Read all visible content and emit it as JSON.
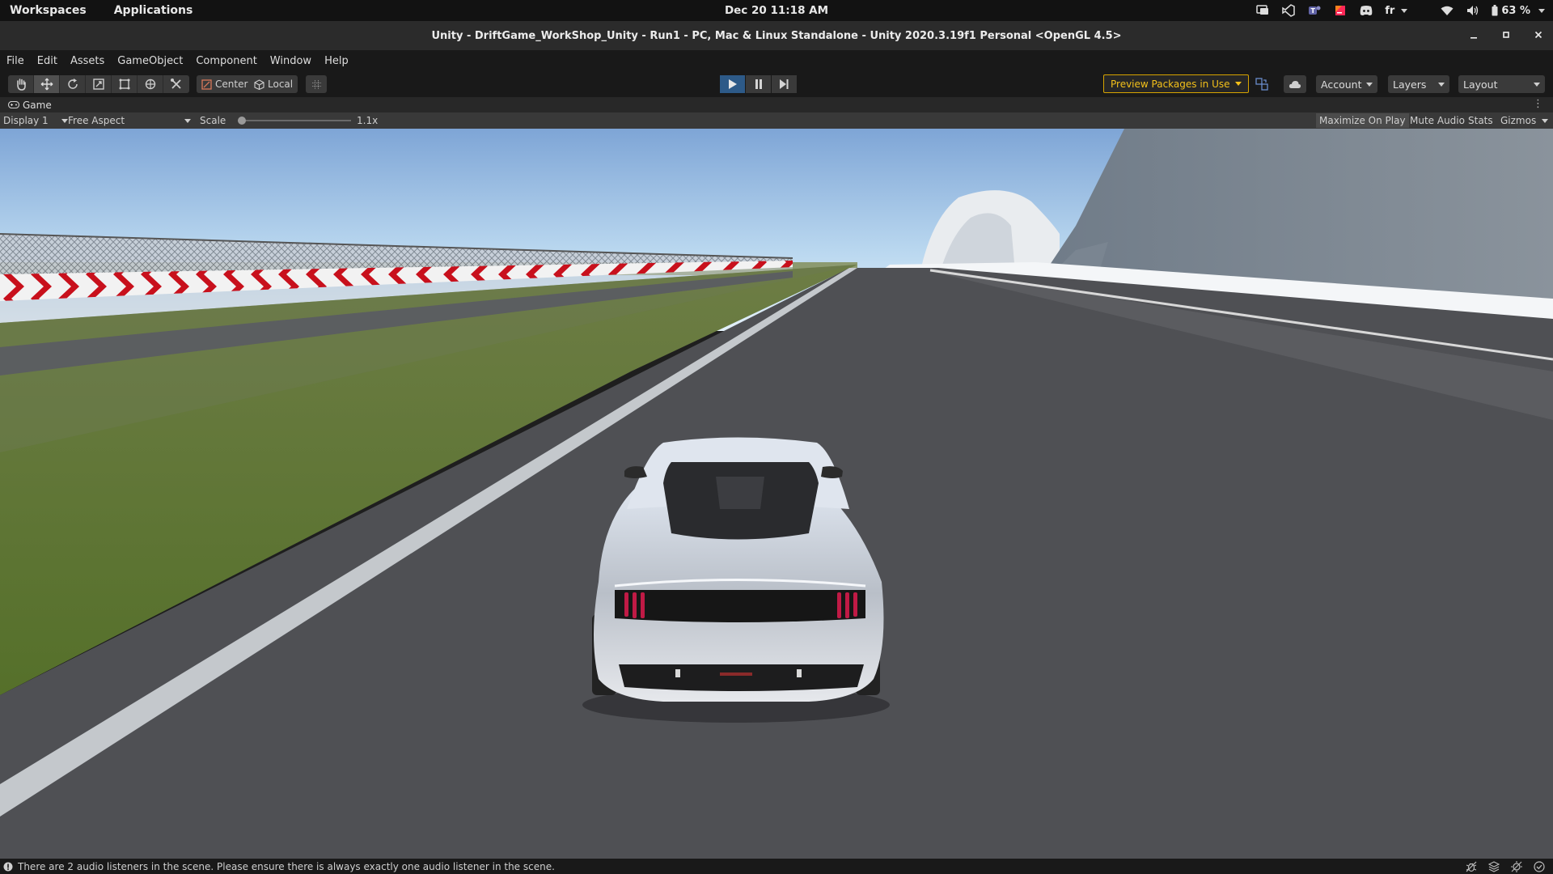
{
  "topbar": {
    "workspaces": "Workspaces",
    "applications": "Applications",
    "clock": "Dec 20  11:18 AM",
    "keyboard_layout": "fr",
    "battery": "63 %"
  },
  "window": {
    "title": "Unity - DriftGame_WorkShop_Unity - Run1 - PC, Mac & Linux Standalone - Unity 2020.3.19f1 Personal <OpenGL 4.5>"
  },
  "menu": [
    "File",
    "Edit",
    "Assets",
    "GameObject",
    "Component",
    "Window",
    "Help"
  ],
  "toolbar": {
    "tools": [
      "hand-tool-icon",
      "move-tool-icon",
      "rotate-tool-icon",
      "scale-tool-icon",
      "rect-tool-icon",
      "transform-tool-icon",
      "custom-tool-icon"
    ],
    "pivot_center": "Center",
    "pivot_local": "Local",
    "preview_packages": "Preview Packages in Use",
    "account": "Account",
    "layers": "Layers",
    "layout": "Layout",
    "play_active": true
  },
  "game_tab": {
    "label": "Game"
  },
  "game_view": {
    "display": "Display 1",
    "aspect": "Free Aspect",
    "scale_label": "Scale",
    "scale_value": "1.1x",
    "maximize_on_play": "Maximize On Play",
    "mute_audio": "Mute Audio",
    "stats": "Stats",
    "gizmos": "Gizmos"
  },
  "status": {
    "message": "There are 2 audio listeners in the scene. Please ensure there is always exactly one audio listener in the scene."
  },
  "colors": {
    "preview_accent": "#f3c01a",
    "play_active": "#2d5a88",
    "sky_top": "#7fa6d6",
    "sky_bottom": "#d9ecf8",
    "road": "#4f5054",
    "grass": "#5f7a30",
    "kerb_red": "#c8101c"
  }
}
